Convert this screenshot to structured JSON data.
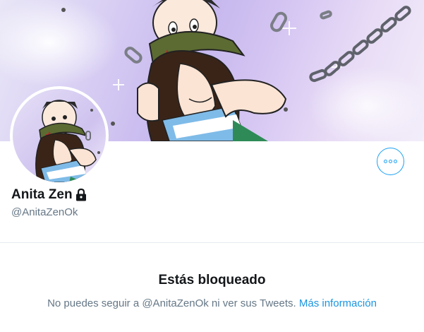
{
  "profile": {
    "display_name": "Anita Zen",
    "handle": "@AnitaZenOk",
    "protected_icon": "lock-icon"
  },
  "actions": {
    "more_icon": "more-dots-icon"
  },
  "blocked": {
    "title": "Estás bloqueado",
    "message": "No puedes seguir a @AnitaZenOk ni ver sus Tweets.",
    "link_label": "Más información"
  },
  "colors": {
    "accent": "#1da1f2",
    "link": "#1b95e0",
    "muted": "#657786",
    "text": "#14171a"
  }
}
